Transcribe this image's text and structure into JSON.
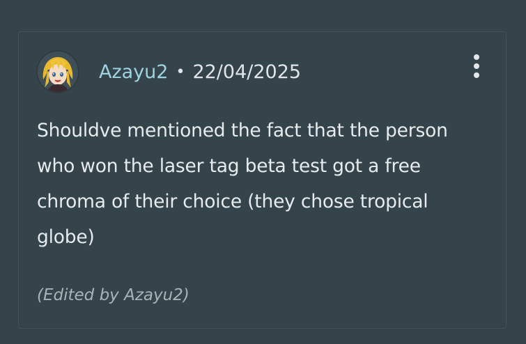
{
  "comment": {
    "username": "Azayu2",
    "separator": "•",
    "date": "22/04/2025",
    "body": "Shouldve mentioned the fact that the person who won the laser tag beta test got a free chroma of their choice (they chose tropical globe)",
    "edited_note": "(Edited by Azayu2)",
    "avatar_icon": "user-avatar-anime-blonde",
    "more_icon": "vertical-ellipsis-icon"
  },
  "colors": {
    "background": "#35434a",
    "username": "#9ed3df",
    "text": "#e6ebed",
    "muted": "#aab4b8"
  }
}
